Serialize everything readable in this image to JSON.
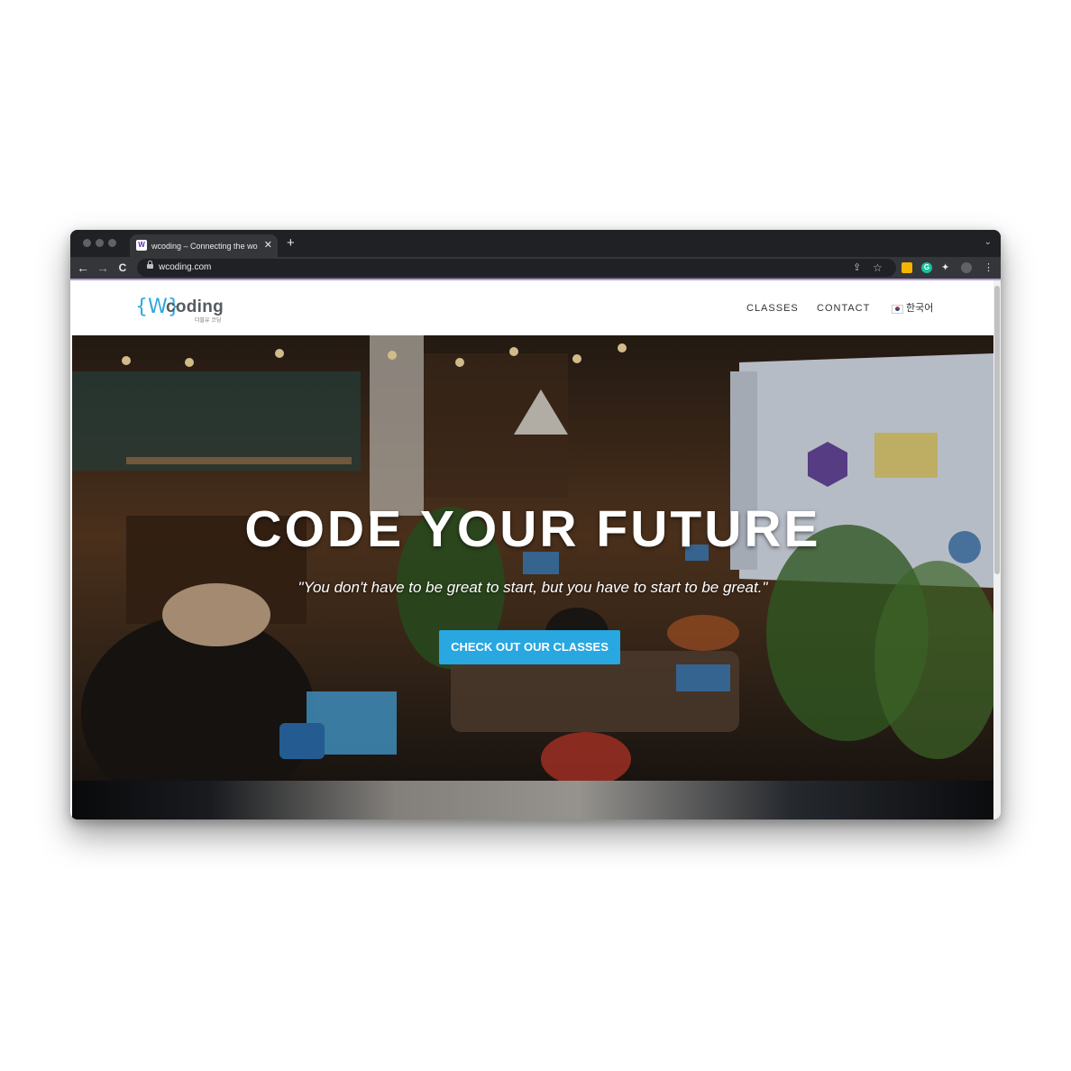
{
  "browser": {
    "tab_title": "wcoding – Connecting the wor",
    "tab_favicon": "W",
    "tab_close": "✕",
    "new_tab": "+",
    "tablist_chevron": "⌄",
    "url": "wcoding.com",
    "icons": {
      "back": "←",
      "forward": "→",
      "reload": "C",
      "share": "⇪",
      "bookmark": "☆",
      "extensions": "✦",
      "menu": "⋮"
    },
    "extension_colors": [
      "#f4b400",
      "#15c39a"
    ]
  },
  "site": {
    "logo": {
      "braces": "{W}",
      "word": "coding",
      "sub": "더블유 코딩"
    },
    "nav": {
      "classes": "CLASSES",
      "contact": "CONTACT",
      "language": "한국어"
    },
    "hero": {
      "headline": "CODE YOUR FUTURE",
      "quote": "\"You don't have to be great to start, but you have to start to be great.\"",
      "cta": "CHECK OUT OUR CLASSES"
    },
    "colors": {
      "accent": "#28a7e0",
      "logo_text": "#555b61"
    }
  }
}
